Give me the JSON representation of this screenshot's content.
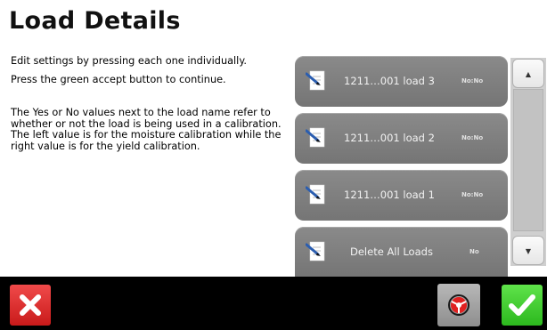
{
  "header": {
    "title": "Load Details"
  },
  "instructions": {
    "p1": "Edit settings by pressing each one individually.",
    "p2": "Press the green accept button to continue.",
    "p3": "The Yes or No values next to the load name refer to whether or not the load is being used in a calibration. The left value is for the moisture calibration while the right value is for the yield calibration."
  },
  "loads": [
    {
      "label": "1211…001 load 3",
      "flag": "No:No",
      "icon": "document-pencil-icon"
    },
    {
      "label": "1211…001 load 2",
      "flag": "No:No",
      "icon": "document-pencil-icon"
    },
    {
      "label": "1211…001 load 1",
      "flag": "No:No",
      "icon": "document-pencil-icon"
    },
    {
      "label": "Delete All Loads",
      "flag": "No",
      "icon": "document-pencil-icon"
    }
  ],
  "scrollbar": {
    "up_icon": "arrow-up-icon",
    "down_icon": "arrow-down-icon"
  },
  "footer": {
    "cancel_icon": "x-icon",
    "steering_icon": "steering-wheel-icon",
    "accept_icon": "checkmark-icon"
  },
  "colors": {
    "cancel": "#d62626",
    "accept": "#3fcc2e",
    "load_button": "#808080",
    "steering_accent": "#e02020"
  }
}
